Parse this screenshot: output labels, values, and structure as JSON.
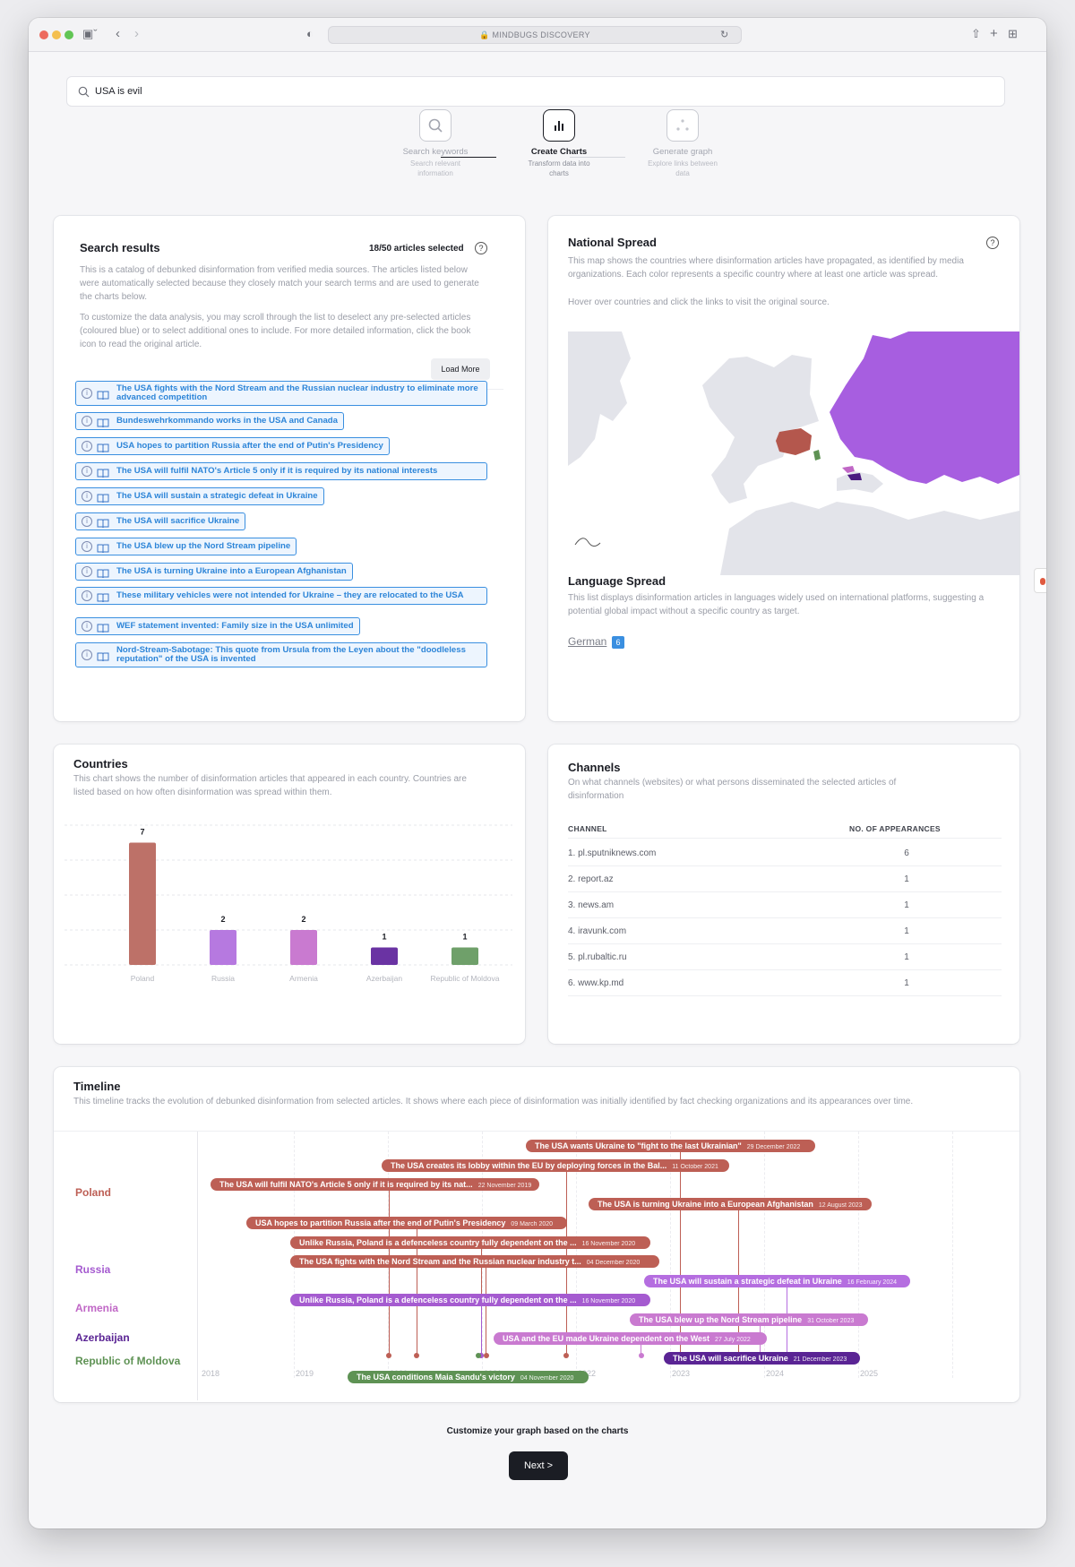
{
  "browser": {
    "url": "MINDBUGS DISCOVERY"
  },
  "search": {
    "value": "USA is evil"
  },
  "steps": [
    {
      "title": "Search keywords",
      "sub": "Search relevant information"
    },
    {
      "title": "Create Charts",
      "sub": "Transform data into charts"
    },
    {
      "title": "Generate graph",
      "sub": "Explore links between data"
    }
  ],
  "search_results": {
    "title": "Search results",
    "count": "18/50 articles selected",
    "desc1": "This is a catalog of debunked disinformation from verified media sources. The articles listed below were automatically selected because they closely match your search terms and are used to generate the charts below.",
    "desc2": "To customize the data analysis, you may scroll through the list to deselect any pre-selected articles (coloured blue) or to select additional ones to include. For more detailed information, click the book icon to read the original article.",
    "load_more": "Load More",
    "articles": [
      "The USA fights with the Nord Stream and the Russian nuclear industry to eliminate more advanced competition",
      "Bundeswehrkommando works in the USA and Canada",
      "USA hopes to partition Russia after the end of Putin's Presidency",
      "The USA will fulfil NATO's Article 5 only if it is required by its national interests",
      "The USA will sustain a strategic defeat in Ukraine",
      "The USA will sacrifice Ukraine",
      "The USA blew up the Nord Stream pipeline",
      "The USA is turning Ukraine into a European Afghanistan",
      "These military vehicles were not intended for Ukraine – they are relocated to the USA",
      "WEF statement invented: Family size in the USA unlimited",
      "Nord-Stream-Sabotage: This quote from Ursula from the Leyen about the \"doodleless reputation\" of the USA is invented"
    ]
  },
  "national_spread": {
    "title": "National Spread",
    "desc": "This map shows the countries where disinformation articles have propagated, as identified by media organizations. Each color represents a specific country where at least one article was spread.",
    "hint": "Hover over countries and click the links to visit the original source."
  },
  "language_spread": {
    "title": "Language Spread",
    "desc": "This list displays disinformation articles in languages widely used on international platforms, suggesting a potential global impact without a specific country as target.",
    "language": "German",
    "language_count": "6"
  },
  "countries_chart": {
    "title": "Countries",
    "desc": "This chart shows the number of disinformation articles that appeared in each country. Countries are listed based on how often disinformation was spread within them."
  },
  "chart_data": {
    "type": "bar",
    "categories": [
      "Poland",
      "Russia",
      "Armenia",
      "Azerbaijan",
      "Republic of Moldova"
    ],
    "values": [
      7,
      2,
      2,
      1,
      1
    ],
    "colors": [
      "#bd7168",
      "#b679e0",
      "#c97ad0",
      "#6a33a3",
      "#6fa06a"
    ],
    "ylim": [
      0,
      8
    ]
  },
  "channels": {
    "title": "Channels",
    "desc": "On what channels (websites) or what persons disseminated the selected articles of disinformation",
    "col_channel": "CHANNEL",
    "col_count": "NO. OF APPEARANCES",
    "rows": [
      {
        "name": "1. pl.sputniknews.com",
        "count": "6"
      },
      {
        "name": "2. report.az",
        "count": "1"
      },
      {
        "name": "3. news.am",
        "count": "1"
      },
      {
        "name": "4. iravunk.com",
        "count": "1"
      },
      {
        "name": "5. pl.rubaltic.ru",
        "count": "1"
      },
      {
        "name": "6. www.kp.md",
        "count": "1"
      }
    ]
  },
  "timeline": {
    "title": "Timeline",
    "desc": "This timeline tracks the evolution of debunked disinformation from selected articles. It shows where each piece of disinformation was initially identified by fact checking organizations and its appearances over time.",
    "countries": [
      {
        "name": "Poland",
        "color": "#bd5f55"
      },
      {
        "name": "Russia",
        "color": "#a55bd0"
      },
      {
        "name": "Armenia",
        "color": "#c067c6"
      },
      {
        "name": "Azerbaijan",
        "color": "#5a2494"
      },
      {
        "name": "Republic of Moldova",
        "color": "#5e9254"
      }
    ],
    "years": [
      "2018",
      "2019",
      "2020",
      "2021",
      "2022",
      "2023",
      "2024",
      "2025"
    ],
    "events": [
      {
        "text": "The USA wants Ukraine to \"fight to the last Ukrainian\"",
        "date": "29 December 2022",
        "color": "#bd5f55"
      },
      {
        "text": "The USA creates its lobby within the EU by deploying forces in the Bal...",
        "date": "11 October 2021",
        "color": "#bd5f55"
      },
      {
        "text": "The USA will fulfil NATO's Article 5 only if it is required by its nat...",
        "date": "22 November 2019",
        "color": "#bd5f55"
      },
      {
        "text": "The USA is turning Ukraine into a European Afghanistan",
        "date": "12 August 2023",
        "color": "#bd5f55"
      },
      {
        "text": "USA hopes to partition Russia after the end of Putin's Presidency",
        "date": "09 March 2020",
        "color": "#bd5f55"
      },
      {
        "text": "Unlike Russia, Poland is a defenceless country fully dependent on the ...",
        "date": "16 November 2020",
        "color": "#bd5f55"
      },
      {
        "text": "The USA fights with the Nord Stream and the Russian nuclear industry t...",
        "date": "04 December 2020",
        "color": "#bd5f55"
      },
      {
        "text": "The USA will sustain a strategic defeat in Ukraine",
        "date": "16 February 2024",
        "color": "#b56ee0"
      },
      {
        "text": "Unlike Russia, Poland is a defenceless country fully dependent on the ...",
        "date": "16 November 2020",
        "color": "#a55bd0"
      },
      {
        "text": "The USA blew up the Nord Stream pipeline",
        "date": "31 October 2023",
        "color": "#c97ad0"
      },
      {
        "text": "USA and the EU made Ukraine dependent on the West",
        "date": "27 July 2022",
        "color": "#c97ad0"
      },
      {
        "text": "The USA will sacrifice Ukraine",
        "date": "21 December 2023",
        "color": "#5a2494"
      },
      {
        "text": "The USA conditions Maia Sandu's victory",
        "date": "04 November 2020",
        "color": "#5e9254"
      }
    ]
  },
  "footer": {
    "cta": "Customize your graph based on the charts",
    "next": "Next >"
  }
}
